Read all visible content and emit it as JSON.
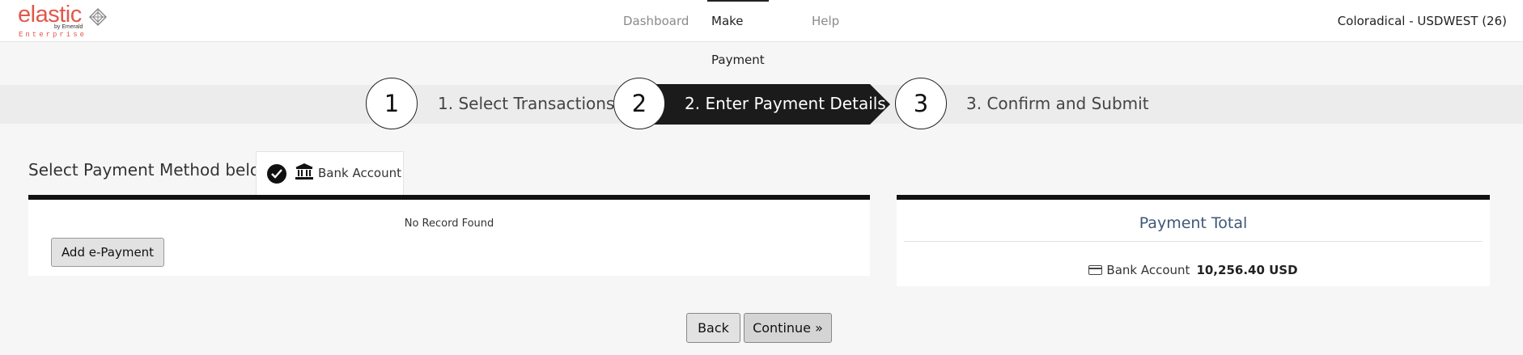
{
  "brand": {
    "name": "elastic",
    "by": "by Emerald",
    "edition": "Enterprise",
    "color": "#e2574c"
  },
  "nav": {
    "items": [
      {
        "label": "Dashboard",
        "active": false
      },
      {
        "label": "Make Payment",
        "active": true
      },
      {
        "label": "Help",
        "active": false
      }
    ]
  },
  "user": {
    "label": "Coloradical - USDWEST (26)"
  },
  "stepper": {
    "steps": [
      {
        "number": "1",
        "label": "1. Select Transactions",
        "active": false
      },
      {
        "number": "2",
        "label": "2. Enter Payment Details",
        "active": true
      },
      {
        "number": "3",
        "label": "3. Confirm and Submit",
        "active": false
      }
    ]
  },
  "payment_method": {
    "prompt": "Select Payment Method below:",
    "selected": {
      "label": "Bank Account",
      "icon": "bank-icon",
      "checked_icon": "check-circle-icon"
    }
  },
  "records": {
    "empty_text": "No Record Found",
    "add_button": "Add e-Payment"
  },
  "payment_total": {
    "title": "Payment Total",
    "method_label": "Bank Account",
    "method_icon": "credit-card-icon",
    "amount": "10,256.40 USD"
  },
  "actions": {
    "back": "Back",
    "continue": "Continue »"
  }
}
